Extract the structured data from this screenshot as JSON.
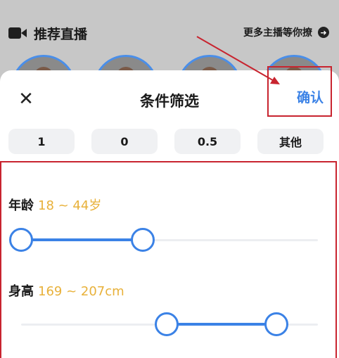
{
  "background": {
    "section_title": "推荐直播",
    "more_label": "更多主播等你撩",
    "more_icon": "chevron-right-icon"
  },
  "sheet": {
    "close_icon": "close-icon",
    "close_glyph": "✕",
    "title": "条件筛选",
    "confirm_label": "确认"
  },
  "chips": [
    "1",
    "0",
    "0.5",
    "其他"
  ],
  "filters": {
    "age": {
      "label": "年龄",
      "value_text": "18 ~ 44岁",
      "min": 0.0,
      "max": 0.41
    },
    "height": {
      "label": "身高",
      "value_text": "169 ~ 207cm",
      "min": 0.49,
      "max": 0.86
    }
  },
  "colors": {
    "accent": "#3b82e6",
    "value_text": "#e8b13a",
    "annotation": "#c8242f"
  }
}
